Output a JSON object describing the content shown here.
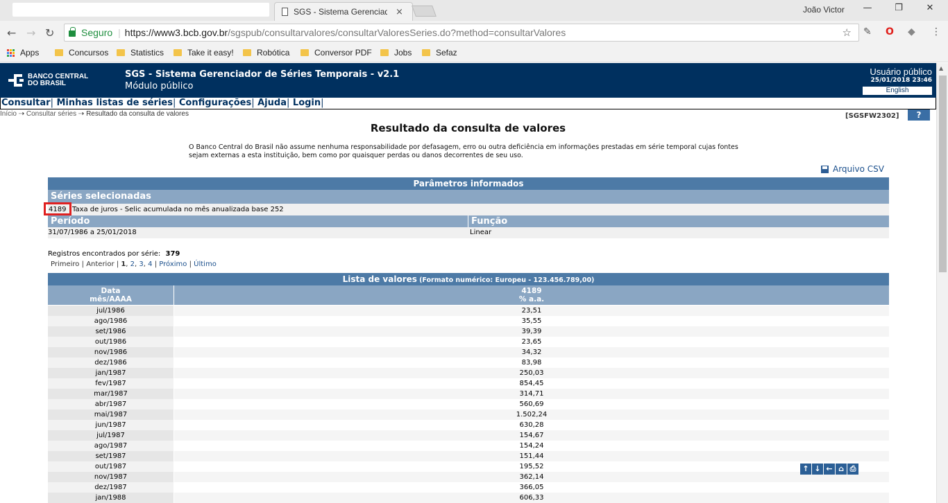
{
  "browser": {
    "tab_title": "SGS - Sistema Gerenciad",
    "tab_close": "×",
    "user": "João Victor",
    "window": {
      "minimize": "—",
      "restore": "❐",
      "close": "✕"
    },
    "secure_label": "Seguro",
    "url_host": "https://www3.bcb.gov.br",
    "url_path": "/sgspub/consultarvalores/consultarValoresSeries.do?method=consultarValores",
    "bookmarks": [
      {
        "label": "Apps"
      },
      {
        "label": "Concursos"
      },
      {
        "label": "Statistics"
      },
      {
        "label": "Take it easy!"
      },
      {
        "label": "Robótica"
      },
      {
        "label": "Conversor PDF"
      },
      {
        "label": "Jobs"
      },
      {
        "label": "Sefaz"
      }
    ]
  },
  "header": {
    "logo_line1": "BANCO CENTRAL",
    "logo_line2": "DO BRASIL",
    "title": "SGS - Sistema Gerenciador de Séries Temporais - v2.1",
    "subtitle": "Módulo público",
    "user": "Usuário público",
    "datetime": "25/01/2018 23:46",
    "language": "English"
  },
  "menu": {
    "consultar": "Consultar",
    "minhas": "Minhas listas de séries",
    "config": "Configurações",
    "ajuda": "Ajuda",
    "login": "Login",
    "pipe": "|"
  },
  "breadcrumb": {
    "inicio": "Início",
    "arrow": "⇢",
    "consultar": "Consultar séries",
    "current": "Resultado da consulta de valores"
  },
  "code": "[SGSFW2302]",
  "help": "?",
  "page_title": "Resultado da consulta de valores",
  "disclaimer": "O Banco Central do Brasil não assume nenhuma responsabilidade por defasagem, erro ou outra deficiência em informações prestadas em série temporal cujas fontes sejam externas a esta instituição, bem como por quaisquer perdas ou danos decorrentes de seu uso.",
  "csv_label": "Arquivo CSV",
  "params": {
    "title": "Parâmetros informados",
    "series_header": "Séries selecionadas",
    "series_code": "4189",
    "series_desc": "Taxa de juros - Selic acumulada no mês anualizada base 252",
    "period_header": "Período",
    "function_header": "Função",
    "period": "31/07/1986 a 25/01/2018",
    "function": "Linear"
  },
  "records": {
    "label": "Registros encontrados por série:",
    "count": "379"
  },
  "pager": {
    "first": "Primeiro",
    "prev": "Anterior",
    "current": "1",
    "p2": "2",
    "p3": "3",
    "p4": "4",
    "next": "Próximo",
    "last": "Último",
    "sep": "|",
    "comma": ","
  },
  "values": {
    "title": "Lista de valores",
    "format": "(Formato numérico: Europeu - 123.456.789,00)",
    "col1_line1": "Data",
    "col1_line2": "mês/AAAA",
    "col2_line1": "4189",
    "col2_line2": "% a.a.",
    "rows": [
      {
        "date": "jul/1986",
        "value": "23,51"
      },
      {
        "date": "ago/1986",
        "value": "35,55"
      },
      {
        "date": "set/1986",
        "value": "39,39"
      },
      {
        "date": "out/1986",
        "value": "23,65"
      },
      {
        "date": "nov/1986",
        "value": "34,32"
      },
      {
        "date": "dez/1986",
        "value": "83,98"
      },
      {
        "date": "jan/1987",
        "value": "250,03"
      },
      {
        "date": "fev/1987",
        "value": "854,45"
      },
      {
        "date": "mar/1987",
        "value": "314,71"
      },
      {
        "date": "abr/1987",
        "value": "560,69"
      },
      {
        "date": "mai/1987",
        "value": "1.502,24"
      },
      {
        "date": "jun/1987",
        "value": "630,28"
      },
      {
        "date": "jul/1987",
        "value": "154,67"
      },
      {
        "date": "ago/1987",
        "value": "154,24"
      },
      {
        "date": "set/1987",
        "value": "151,44"
      },
      {
        "date": "out/1987",
        "value": "195,52"
      },
      {
        "date": "nov/1987",
        "value": "362,14"
      },
      {
        "date": "dez/1987",
        "value": "366,05"
      },
      {
        "date": "jan/1988",
        "value": "606,33"
      }
    ]
  },
  "float_nav": {
    "up": "↑",
    "down": "↓",
    "back": "←",
    "home": "⌂",
    "print": "⎙"
  }
}
